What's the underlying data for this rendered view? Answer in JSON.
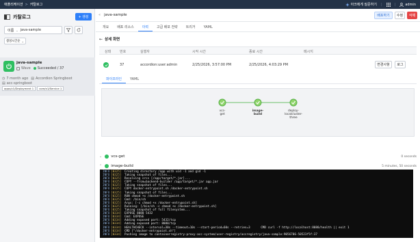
{
  "topbar": {
    "crumb1": "애플리케이션",
    "crumb_sep": ">",
    "crumb2": "카탈로그",
    "ask_ai": "아크에게 질문하기",
    "user": "admin",
    "grid_icon": "grid-icon",
    "sep": "|"
  },
  "sidebar": {
    "title": "카탈로그",
    "create_label": "+ 생성",
    "filter_select": "이름",
    "search_value": "java-sample",
    "sort_label": "생성시간순",
    "app": {
      "name": "java-sample",
      "tag": "Wave",
      "status": "Succeeded / 37",
      "time": "7 month ago",
      "framework": "Accordion Springboot",
      "repo": "acc-springboot",
      "resources": [
        "apps/v1/Deployment 1",
        "core/v1/Service 1"
      ]
    }
  },
  "main": {
    "header_title": "java-sample",
    "actions": {
      "deploy": "배포하기",
      "edit": "수정",
      "delete": "삭제"
    },
    "tabs": [
      "개요",
      "배포 리소스",
      "이력",
      "고급 배포 전략",
      "트리거",
      "YAML"
    ],
    "active_tab": 2,
    "back_label": "상세 화면",
    "history_table": {
      "headers": [
        "상태",
        "번호",
        "실행자",
        "시작 시간",
        "종료 시간",
        "메시지"
      ],
      "row": {
        "number": "37",
        "runner": "accordion:user:admin",
        "start": "2/25/2026, 3:57:00 PM",
        "end": "2/25/2026, 4:03:29 PM",
        "message": ""
      },
      "row_buttons": [
        "변경사항",
        "로그"
      ]
    },
    "sub_tabs": [
      "파이프라인",
      "YAML"
    ],
    "active_sub_tab": 0,
    "pipeline_nodes": [
      {
        "label": "vcs-\nget",
        "bold": false
      },
      {
        "label": "image-\nbuild",
        "bold": true
      },
      {
        "label": "deploy-\nlocalcluster-\nthree",
        "bold": false
      }
    ],
    "steps": [
      {
        "name": "vcs-get",
        "duration": "0 seconds"
      },
      {
        "name": "image-build",
        "duration": "5 minutes, 50 seconds"
      }
    ],
    "log_level": "INFO",
    "log_lines": [
      [
        "[0325]",
        "Creating directory /app with uid -1 and gid -1"
      ],
      [
        "[0325]",
        "Taking snapshot of files..."
      ],
      [
        "[0325]",
        "Resolving srcs [/app/target/*.jar]..."
      ],
      [
        "[0325]",
        "COPY --from=backend-builder /app/target/*.jar app.jar"
      ],
      [
        "[0325]",
        "Taking snapshot of files..."
      ],
      [
        "[0325]",
        "COPY docker-entrypoint.sh /docker-entrypoint.sh"
      ],
      [
        "[0325]",
        "Taking snapshot of files..."
      ],
      [
        "[0325]",
        "RUN chmod +x /docker-entrypoint.sh"
      ],
      [
        "[0325]",
        "Cmd: /bin/sh"
      ],
      [
        "[0325]",
        "Args: [-c chmod +x /docker-entrypoint.sh]"
      ],
      [
        "[0325]",
        "Running: [/bin/sh -c chmod +x /docker-entrypoint.sh]"
      ],
      [
        "[0325]",
        "Taking snapshot of full filesystem..."
      ],
      [
        "[0334]",
        "EXPOSE 8080 5432"
      ],
      [
        "[0334]",
        "Cmd: EXPOSE"
      ],
      [
        "[0334]",
        "Adding exposed port: 5432/tcp"
      ],
      [
        "[0334]",
        "Adding exposed port: 8080/tcp"
      ],
      [
        "[0334]",
        "HEALTHCHECK --interval=30s --timeout=10s --start-period=60s --retries=3      CMD curl -f http://localhost:8080/health || exit 1"
      ],
      [
        "[0334]",
        "CMD [\"/docker-entrypoint.sh\"]"
      ],
      [
        "[0334]",
        "Pushing image to containerregistry-proxy-acc-system/user-registry/accregistry/java-sample:9056786-50523f5f:37"
      ]
    ]
  }
}
